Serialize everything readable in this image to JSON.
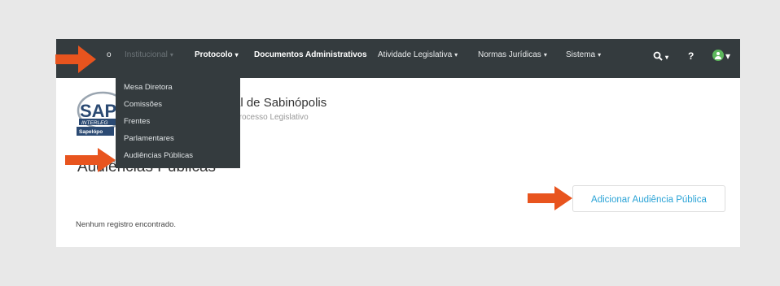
{
  "navbar": {
    "items": [
      {
        "label": "o",
        "caret": ""
      },
      {
        "label": "Institucional",
        "caret": "▾"
      },
      {
        "label": "Protocolo",
        "caret": "▾"
      },
      {
        "label": "Documentos Administrativos",
        "caret": ""
      },
      {
        "label": "Atividade Legislativa",
        "caret": "▾"
      },
      {
        "label": "Normas Jurídicas",
        "caret": "▾"
      },
      {
        "label": "Sistema",
        "caret": "▾"
      }
    ],
    "search_icon": "search-icon",
    "search_caret": "▾",
    "help_label": "?",
    "user_caret": "▾",
    "user_icon": "user-avatar-icon"
  },
  "dropdown": {
    "items": [
      "Mesa Diretora",
      "Comissões",
      "Frentes",
      "Parlamentares",
      "Audiências Públicas"
    ]
  },
  "header": {
    "logo_text": "SAP",
    "logo_band": "INTERLEG",
    "logo_caption": "Sapelópo",
    "title": "al de Sabinópolis",
    "subtitle": "Processo Legislativo"
  },
  "main": {
    "heading": "Audiências Públicas",
    "add_button": "Adicionar Audiência Pública",
    "empty_message": "Nenhum registro encontrado."
  },
  "colors": {
    "navbar_bg": "#343b3e",
    "arrow": "#e8541e",
    "link": "#2aa3d6",
    "avatar": "#5cb85c"
  }
}
